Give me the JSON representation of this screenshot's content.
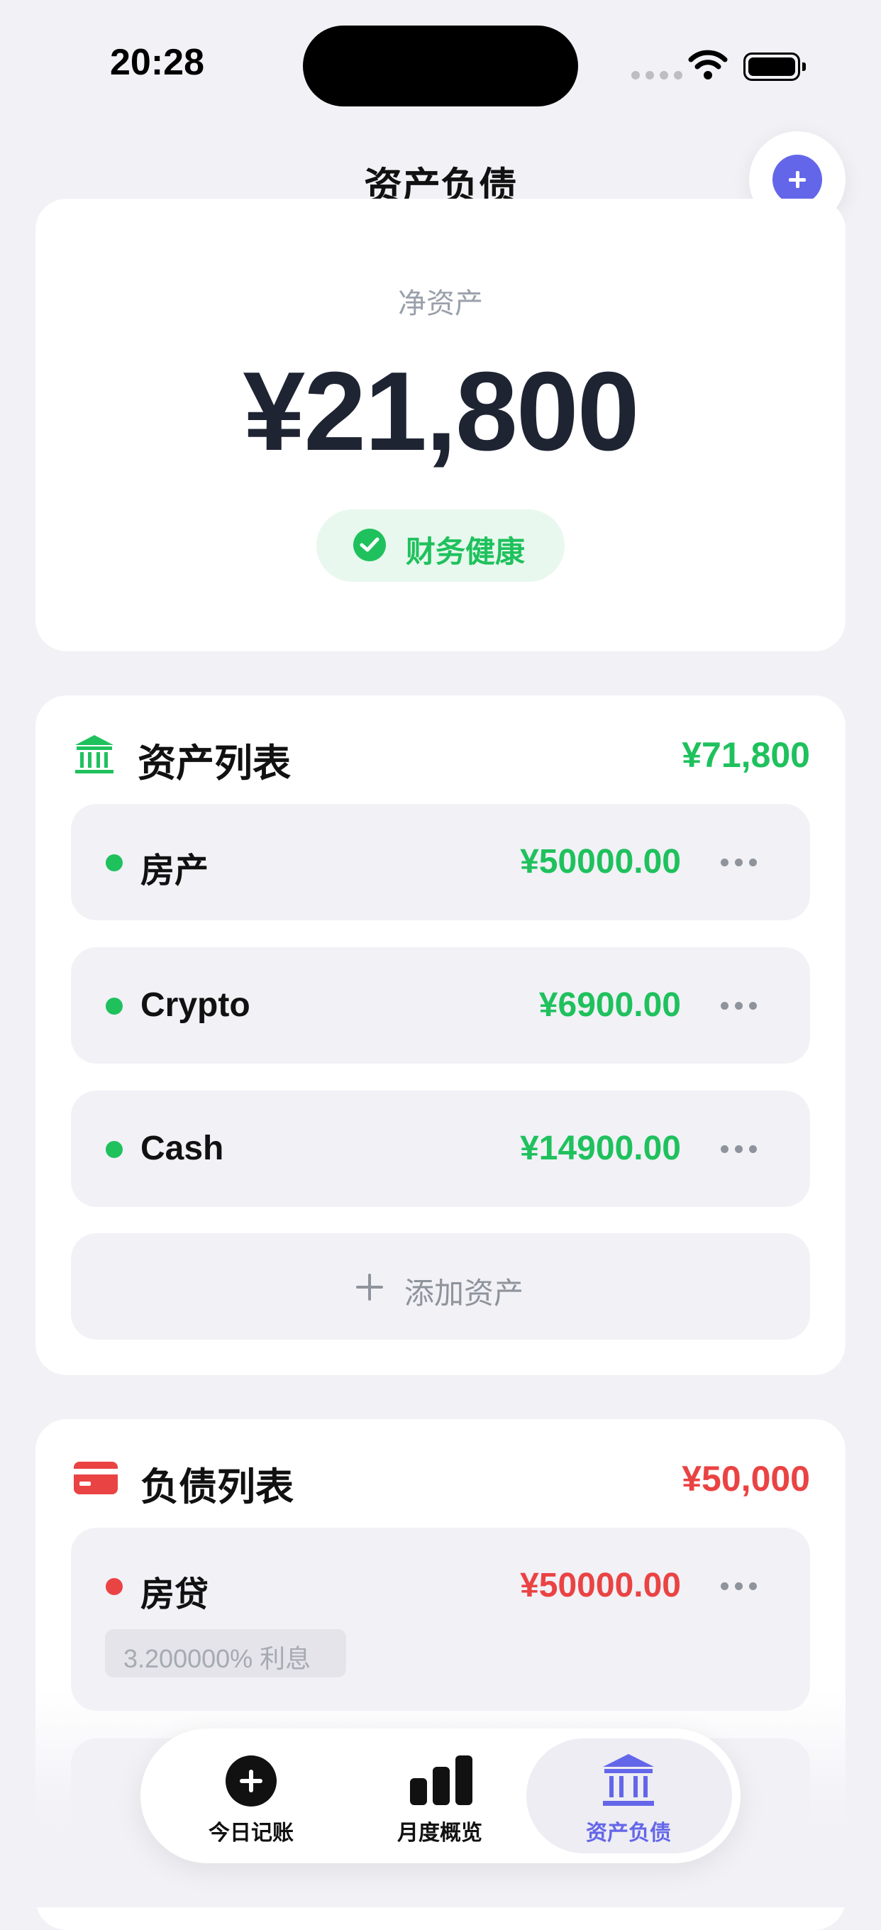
{
  "status_bar": {
    "time": "20:28"
  },
  "header": {
    "title": "资产负债"
  },
  "net_worth": {
    "label": "净资产",
    "value": "¥21,800",
    "status": "财务健康"
  },
  "assets": {
    "title": "资产列表",
    "total": "¥71,800",
    "items": [
      {
        "name": "房产",
        "value": "¥50000.00"
      },
      {
        "name": "Crypto",
        "value": "¥6900.00"
      },
      {
        "name": "Cash",
        "value": "¥14900.00"
      }
    ],
    "add_label": "添加资产"
  },
  "liabilities": {
    "title": "负债列表",
    "total": "¥50,000",
    "items": [
      {
        "name": "房贷",
        "value": "¥50000.00",
        "interest": "3.200000% 利息"
      }
    ]
  },
  "tabbar": {
    "tabs": [
      {
        "label": "今日记账",
        "icon": "plus-circle-icon"
      },
      {
        "label": "月度概览",
        "icon": "bar-chart-icon"
      },
      {
        "label": "资产负债",
        "icon": "bank-icon",
        "active": true
      }
    ]
  },
  "colors": {
    "accent": "#6466e9",
    "asset_green": "#1fc15d",
    "liability_red": "#ea4343",
    "background": "#f1f1f6"
  }
}
